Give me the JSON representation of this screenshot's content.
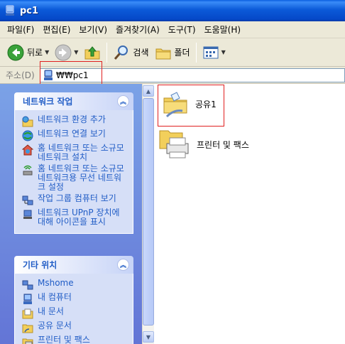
{
  "window": {
    "title": "pc1"
  },
  "menu": [
    "파일(F)",
    "편집(E)",
    "보기(V)",
    "즐겨찾기(A)",
    "도구(T)",
    "도움말(H)"
  ],
  "toolbar": {
    "back_label": "뒤로",
    "search_label": "검색",
    "folders_label": "폴더"
  },
  "address": {
    "label": "주소(D)",
    "value": "₩₩pc1"
  },
  "network_tasks": {
    "title": "네트워크 작업",
    "items": [
      {
        "label": "네트워크 환경 추가",
        "icon": "add-network-place-icon"
      },
      {
        "label": "네트워크 연결 보기",
        "icon": "network-connections-icon"
      },
      {
        "label": "홈 네트워크 또는 소규모 네트워크 설치",
        "icon": "home-network-setup-icon"
      },
      {
        "label": "홈 네트워크 또는 소규모 네트워크용 무선 네트워크 설정",
        "icon": "wireless-network-setup-icon"
      },
      {
        "label": "작업 그룹 컴퓨터 보기",
        "icon": "workgroup-computers-icon"
      },
      {
        "label": "네트워크 UPnP 장치에 대해 아이콘을 표시",
        "icon": "upnp-device-icon"
      }
    ]
  },
  "other_places": {
    "title": "기타 위치",
    "items": [
      {
        "label": "Mshome",
        "icon": "workgroup-icon"
      },
      {
        "label": "내 컴퓨터",
        "icon": "my-computer-icon"
      },
      {
        "label": "내 문서",
        "icon": "my-documents-icon"
      },
      {
        "label": "공유 문서",
        "icon": "shared-documents-icon"
      },
      {
        "label": "프린터 및 팩스",
        "icon": "printers-faxes-icon"
      }
    ]
  },
  "content": {
    "items": [
      {
        "label": "공유1",
        "icon": "shared-folder-icon"
      },
      {
        "label": "프린터 및 팩스",
        "icon": "printers-faxes-icon"
      }
    ]
  },
  "colors": {
    "titlebar": "#0b5ad8",
    "taskpane": "#6f8ee0",
    "link": "#215dc6",
    "highlight_box": "#e02020"
  }
}
